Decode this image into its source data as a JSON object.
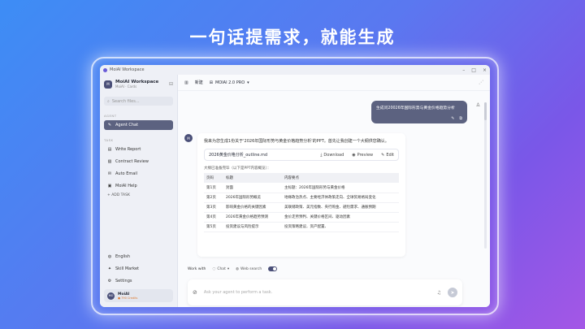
{
  "headline": "一句话提需求，就能生成",
  "window": {
    "title": "MoiAI Workspace"
  },
  "sidebar": {
    "workspace_name": "MoiAI Workspace",
    "workspace_sub": "MoiAI · Cards",
    "search_placeholder": "Search files...",
    "agent_section": "AGENT",
    "agent_item": "Agent Chat",
    "task_section": "TASK",
    "tasks": [
      "Write Report",
      "Contract Review",
      "Auto Email",
      "MoiAI Help"
    ],
    "add_task": "+ ADD TASK",
    "bottom": [
      "English",
      "Skill Market",
      "Settings"
    ],
    "user_name": "MoiAI",
    "user_credits": "● 790 Credits"
  },
  "topbar": {
    "tab": "新建",
    "model": "MOIAI 2.0 PRO"
  },
  "chat": {
    "user_message": "生成问20026年国际形势与黄金价格趋势分析",
    "bot_intro": "我来为您生成1份关于'2026年国际形势与黄金价格趋势分析'的PPT。首先让我创建一个大纲供您确认。",
    "file_name": "2026黄金价格分析_outline.md",
    "file_actions": [
      "Download",
      "Preview",
      "Edit"
    ],
    "outline_label": "大纲已准备完毕（以下是PPT内容概览）：",
    "table": {
      "headers": [
        "页码",
        "标题",
        "内容要点"
      ],
      "rows": [
        [
          "第1页",
          "封面",
          "主标题：2026年国际形势与黄金价格"
        ],
        [
          "第2页",
          "2026年国际形势概览",
          "地缘政治热点、主要经济体政策走向、全球贸易格局变化"
        ],
        [
          "第3页",
          "影响黄金价格的关键因素",
          "美联储政策、美元指数、央行购金、避险需求、通胀预期"
        ],
        [
          "第4页",
          "2026年黄金价格趋势预测",
          "金价走势预判、关键价格区间、驱动因素"
        ],
        [
          "第5页",
          "投资建议与风险提示",
          "投资策略建议、资产配置、"
        ]
      ]
    }
  },
  "composer": {
    "work_with": "Work with",
    "mode": "Chat",
    "web_search": "Web search",
    "placeholder": "Ask your agent to perform a task."
  }
}
